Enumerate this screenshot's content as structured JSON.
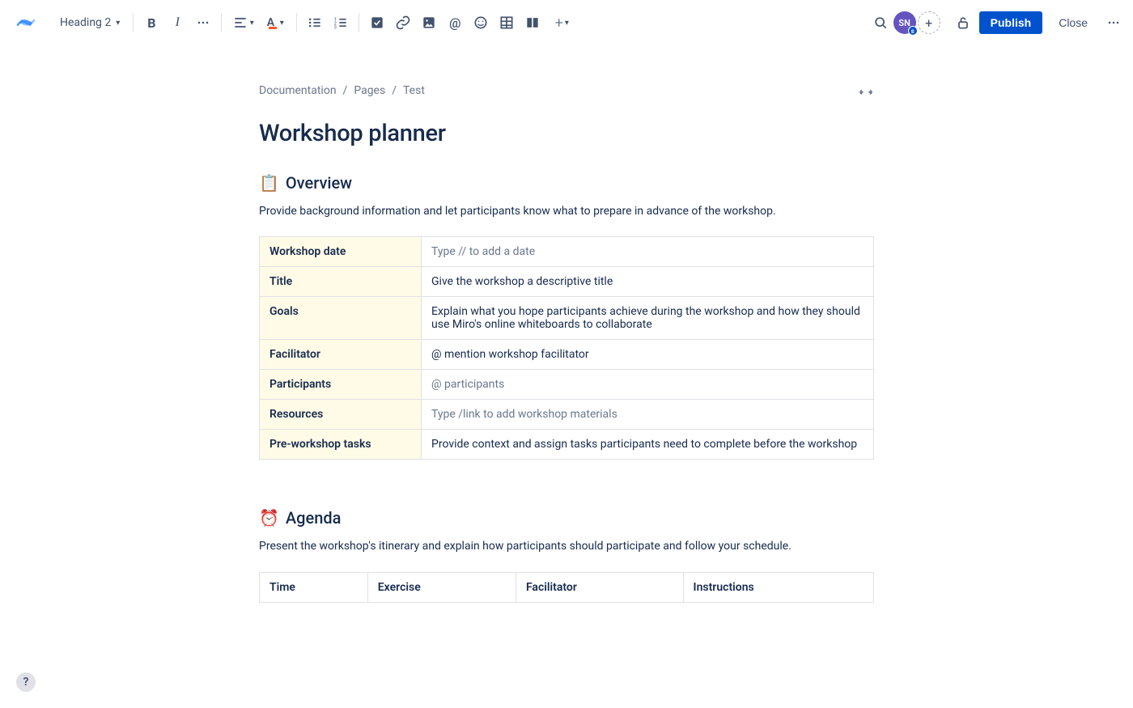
{
  "toolbar": {
    "block_style": "Heading 2",
    "publish_label": "Publish",
    "close_label": "Close"
  },
  "avatar": {
    "initials": "SN",
    "badge": "s"
  },
  "breadcrumb": [
    "Documentation",
    "Pages",
    "Test"
  ],
  "title": "Workshop planner",
  "overview": {
    "emoji": "📋",
    "heading": "Overview",
    "desc": "Provide background information and let participants know what to prepare in advance of the workshop.",
    "rows": [
      {
        "label": "Workshop date",
        "value": "Type // to add a date",
        "placeholder": true
      },
      {
        "label": "Title",
        "value": "Give the workshop a descriptive title",
        "placeholder": false
      },
      {
        "label": "Goals",
        "value": "Explain what you hope participants achieve during the workshop and how they should use Miro's online whiteboards to collaborate",
        "placeholder": false
      },
      {
        "label": "Facilitator",
        "value": "@ mention workshop facilitator",
        "placeholder": false
      },
      {
        "label": "Participants",
        "value": "@ participants",
        "placeholder": true
      },
      {
        "label": "Resources",
        "value": "Type /link to add workshop materials",
        "placeholder": true
      },
      {
        "label": "Pre-workshop tasks",
        "value": "Provide context and assign tasks participants need to complete before the workshop",
        "placeholder": false
      }
    ]
  },
  "agenda": {
    "emoji": "⏰",
    "heading": "Agenda",
    "desc": "Present the workshop's itinerary and explain how participants should participate and follow your schedule.",
    "columns": [
      "Time",
      "Exercise",
      "Facilitator",
      "Instructions"
    ]
  }
}
